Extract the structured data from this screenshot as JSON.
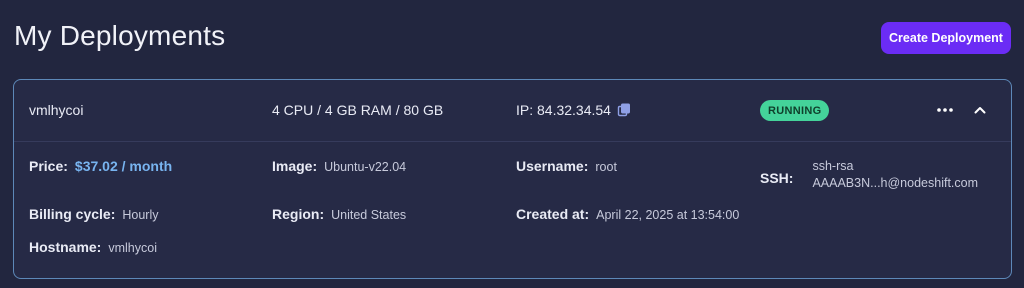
{
  "page": {
    "title": "My Deployments",
    "create_button": "Create Deployment"
  },
  "deployment": {
    "name": "vmlhycoi",
    "specs": "4 CPU / 4 GB RAM / 80 GB",
    "ip": "IP: 84.32.34.54",
    "status": "RUNNING",
    "status_color": "#44d39a",
    "fields": {
      "price_label": "Price:",
      "price_value": "$37.02 / month",
      "image_label": "Image:",
      "image_value": "Ubuntu-v22.04",
      "username_label": "Username:",
      "username_value": "root",
      "ssh_label": "SSH:",
      "ssh_line1": "ssh-rsa",
      "ssh_line2": "AAAAB3N...h@nodeshift.com",
      "billing_label": "Billing cycle:",
      "billing_value": "Hourly",
      "region_label": "Region:",
      "region_value": "United States",
      "created_label": "Created at:",
      "created_value": "April 22, 2025 at 13:54:00",
      "hostname_label": "Hostname:",
      "hostname_value": "vmlhycoi"
    }
  },
  "icons": {
    "copy": "copy-icon",
    "more": "more-horizontal-icon",
    "collapse": "chevron-up-icon"
  },
  "colors": {
    "background": "#22263f",
    "accent_button": "#6b2cf5",
    "card_border": "#5d88b8",
    "price": "#78b4f0"
  }
}
